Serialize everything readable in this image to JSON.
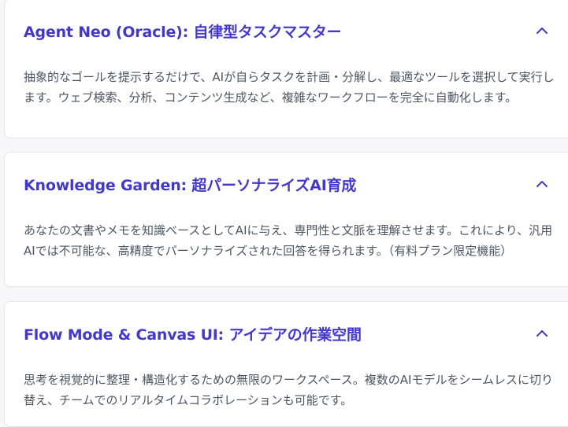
{
  "features": [
    {
      "title": "Agent Neo (Oracle): 自律型タスクマスター",
      "description": "抽象的なゴールを提示するだけで、AIが自らタスクを計画・分解し、最適なツールを選択して実行します。ウェブ検索、分析、コンテンツ生成など、複雑なワークフローを完全に自動化します。",
      "expanded": true,
      "toggle_icon": "chevron-up-icon"
    },
    {
      "title": "Knowledge Garden: 超パーソナライズAI育成",
      "description": "あなたの文書やメモを知識ベースとしてAIに与え、専門性と文脈を理解させます。これにより、汎用AIでは不可能な、高精度でパーソナライズされた回答を得られます。（有料プラン限定機能）",
      "expanded": true,
      "toggle_icon": "chevron-up-icon"
    },
    {
      "title": "Flow Mode & Canvas UI: アイデアの作業空間",
      "description": "思考を視覚的に整理・構造化するための無限のワークスペース。複数のAIモデルをシームレスに切り替え、チームでのリアルタイムコラボレーションも可能です。",
      "expanded": true,
      "toggle_icon": "chevron-up-icon"
    }
  ],
  "colors": {
    "accent": "#4338ca",
    "body_text": "#4b5563",
    "card_background": "#ffffff",
    "card_border": "#e4e4ea",
    "page_background": "#f7f7f9"
  }
}
